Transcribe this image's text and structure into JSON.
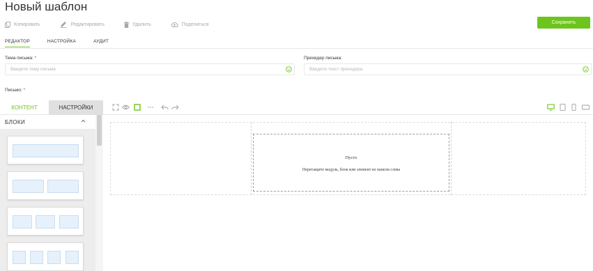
{
  "page": {
    "title": "Новый шаблон"
  },
  "toolbar": {
    "copy_label": "Копировать",
    "edit_label": "Редактировать",
    "delete_label": "Удалить",
    "share_label": "Поделиться",
    "save_label": "Сохранить"
  },
  "tabs": [
    {
      "label": "РЕДАКТОР",
      "active": true
    },
    {
      "label": "НАСТРОЙКА",
      "active": false
    },
    {
      "label": "АУДИТ",
      "active": false
    }
  ],
  "form": {
    "subject_label": "Тема письма:",
    "subject_placeholder": "Введите тему письма",
    "preheader_label": "Прехедер письма:",
    "preheader_placeholder": "Введите текст прехедера",
    "letter_label": "Письмо:",
    "required_mark": "*"
  },
  "panel": {
    "tab_content": "КОНТЕНТ",
    "tab_settings": "НАСТРОЙКИ",
    "blocks_title": "БЛОКИ"
  },
  "canvas": {
    "empty_title": "Пусто",
    "empty_hint": "Перетащите модуль, блок или элемент из панели слева"
  },
  "colors": {
    "accent": "#6cc51c",
    "required": "#e53935"
  },
  "icons": {
    "copy": "copy-icon",
    "edit": "pencil-icon",
    "delete": "trash-icon",
    "share": "cloud-upload-icon",
    "emoji": "smile-icon",
    "fullscreen": "expand-icon",
    "preview": "eye-icon",
    "border": "square-icon",
    "more": "dots-icon",
    "undo": "undo-icon",
    "redo": "redo-icon",
    "desktop": "desktop-icon",
    "tablet": "tablet-icon",
    "mobile": "mobile-icon",
    "landscape": "tablet-landscape-icon"
  }
}
